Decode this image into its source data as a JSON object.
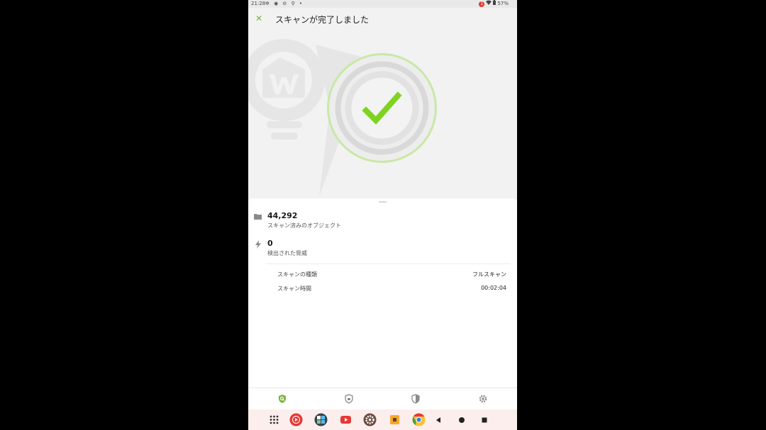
{
  "status_bar": {
    "time": "21:28",
    "notification_count": "1",
    "battery": "57%"
  },
  "header": {
    "close_symbol": "✕",
    "title": "スキャンが完了しました"
  },
  "result": {
    "icon": "check-icon",
    "colors": {
      "accent": "#7ed321",
      "ring": "#c9e8a6"
    }
  },
  "stats": [
    {
      "icon": "folder-icon",
      "value": "44,292",
      "label": "スキャン済みのオブジェクト"
    },
    {
      "icon": "bolt-icon",
      "value": "0",
      "label": "検出された脅威"
    }
  ],
  "details": [
    {
      "label": "スキャンの種類",
      "value": "フルスキャン"
    },
    {
      "label": "スキャン時間",
      "value": "00:02:04"
    }
  ],
  "bottom_nav": [
    {
      "icon": "scan-shield-icon",
      "active": true
    },
    {
      "icon": "shield-icon",
      "active": false
    },
    {
      "icon": "security-shield-icon",
      "active": false
    },
    {
      "icon": "gear-icon",
      "active": false
    }
  ],
  "dock": [
    "app-drawer-icon",
    "youtube-music-icon",
    "app-cluster-icon",
    "youtube-icon",
    "settings-app-icon",
    "files-app-icon",
    "chrome-icon"
  ]
}
